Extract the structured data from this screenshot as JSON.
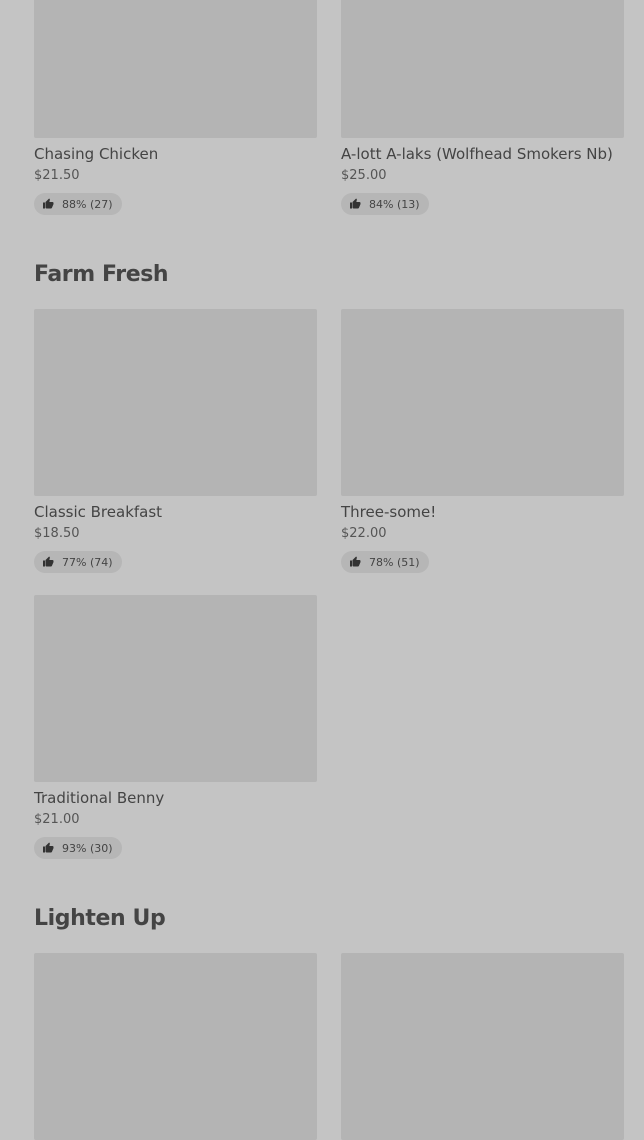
{
  "sections": [
    {
      "title": "",
      "items": [
        {
          "name": "Chasing Chicken",
          "price": "$21.50",
          "rating": "88% (27)"
        },
        {
          "name": "A-lott A-laks (Wolfhead Smokers Nb)",
          "price": "$25.00",
          "rating": "84% (13)"
        }
      ]
    },
    {
      "title": "Farm Fresh",
      "items": [
        {
          "name": "Classic Breakfast",
          "price": "$18.50",
          "rating": "77% (74)"
        },
        {
          "name": "Three-some!",
          "price": "$22.00",
          "rating": "78% (51)"
        },
        {
          "name": "Traditional Benny",
          "price": "$21.00",
          "rating": "93% (30)"
        }
      ]
    },
    {
      "title": "Lighten Up",
      "items": [
        {
          "name": "",
          "price": "",
          "rating": ""
        },
        {
          "name": "",
          "price": "",
          "rating": ""
        }
      ]
    }
  ],
  "icons": {
    "rating": "thumbs-up-icon"
  },
  "colors": {
    "background": "#c4c4c4",
    "image_placeholder": "#b4b4b4",
    "rating_pill": "#b6b6b6"
  }
}
